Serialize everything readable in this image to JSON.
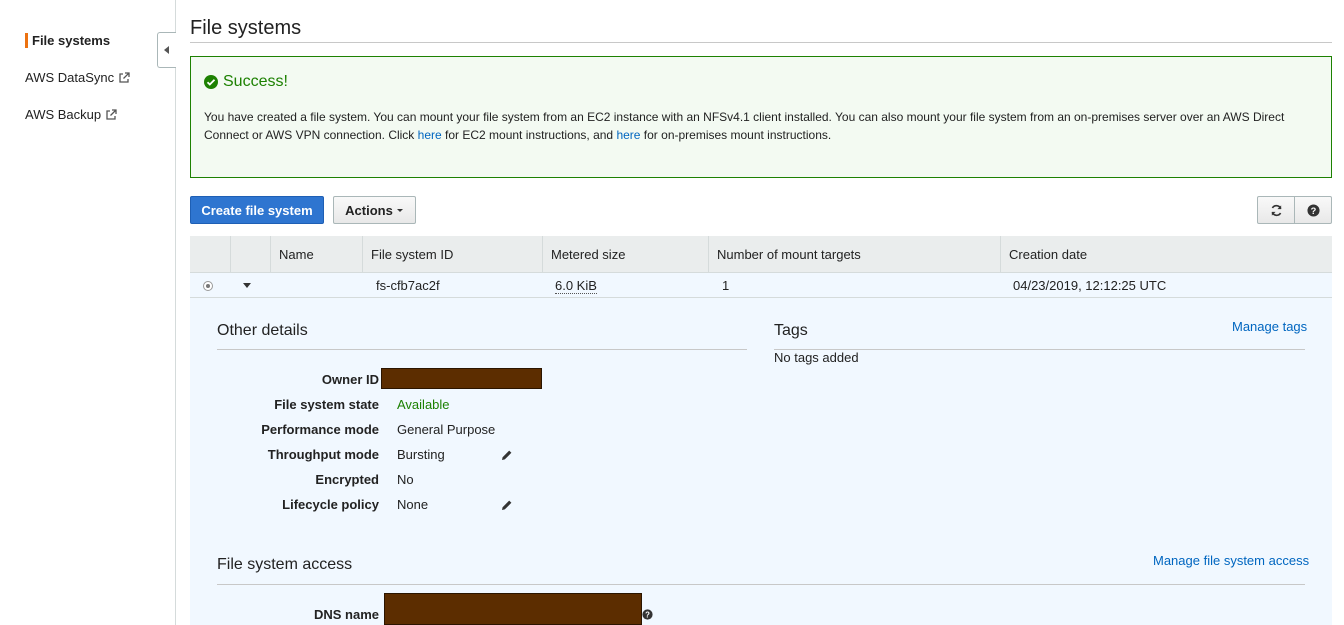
{
  "sidebar": {
    "items": [
      {
        "label": "File systems",
        "active": true
      },
      {
        "label": "AWS DataSync",
        "external": true
      },
      {
        "label": "AWS Backup",
        "external": true
      }
    ]
  },
  "page": {
    "title": "File systems"
  },
  "alert": {
    "title": "Success!",
    "text_1": "You have created a file system. You can mount your file system from an EC2 instance with an NFSv4.1 client installed. You can also mount your file system from an on-premises server over an AWS Direct Connect or AWS VPN connection. Click ",
    "link_1": "here",
    "text_2": " for EC2 mount instructions, and ",
    "link_2": "here",
    "text_3": " for on-premises mount instructions.",
    "color": "#1d8102"
  },
  "toolbar": {
    "create_label": "Create file system",
    "actions_label": "Actions",
    "refresh_icon": "refresh-icon",
    "help_icon": "help-icon"
  },
  "table": {
    "columns": [
      "Name",
      "File system ID",
      "Metered size",
      "Number of mount targets",
      "Creation date"
    ],
    "rows": [
      {
        "name": "",
        "id": "fs-cfb7ac2f",
        "size": "6.0 KiB",
        "mount_targets": "1",
        "created": "04/23/2019, 12:12:25 UTC"
      }
    ]
  },
  "details": {
    "other_title": "Other details",
    "fields": [
      {
        "label": "Owner ID",
        "value": ""
      },
      {
        "label": "File system state",
        "value": "Available"
      },
      {
        "label": "Performance mode",
        "value": "General Purpose"
      },
      {
        "label": "Throughput mode",
        "value": "Bursting"
      },
      {
        "label": "Encrypted",
        "value": "No"
      },
      {
        "label": "Lifecycle policy",
        "value": "None"
      }
    ],
    "tags_title": "Tags",
    "manage_tags": "Manage tags",
    "no_tags": "No tags added",
    "access_title": "File system access",
    "manage_access": "Manage file system access",
    "dns_label": "DNS name"
  },
  "colors": {
    "primary": "#2e75d0",
    "accent": "#ec7211",
    "redaction": "#5c2d00",
    "link": "#0066c0"
  }
}
